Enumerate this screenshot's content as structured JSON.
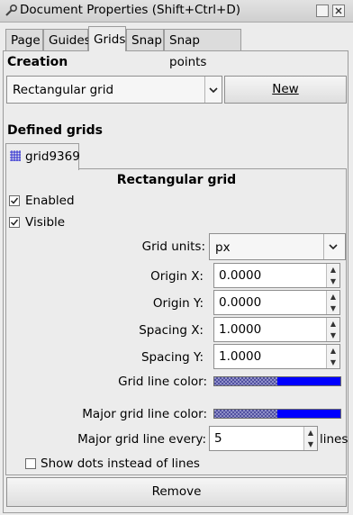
{
  "window": {
    "title": "Document Properties (Shift+Ctrl+D)"
  },
  "tabs": [
    {
      "label": "Page"
    },
    {
      "label": "Guides"
    },
    {
      "label": "Grids",
      "active": true
    },
    {
      "label": "Snap"
    },
    {
      "label": "Snap points"
    }
  ],
  "creation": {
    "heading": "Creation",
    "grid_type_selected": "Rectangular grid",
    "new_button_label": "New"
  },
  "defined_grids": {
    "heading": "Defined grids",
    "grid_tab_label": "grid9369",
    "grid_heading": "Rectangular grid",
    "enabled_label": "Enabled",
    "enabled_checked": true,
    "visible_label": "Visible",
    "visible_checked": true,
    "grid_units_label": "Grid units:",
    "grid_units_value": "px",
    "origin_x_label": "Origin X:",
    "origin_x_value": "0.0000",
    "origin_y_label": "Origin Y:",
    "origin_y_value": "0.0000",
    "spacing_x_label": "Spacing X:",
    "spacing_x_value": "1.0000",
    "spacing_y_label": "Spacing Y:",
    "spacing_y_value": "1.0000",
    "grid_line_color_label": "Grid line color:",
    "grid_line_color": "#0000ff",
    "major_grid_line_color_label": "Major grid line color:",
    "major_grid_line_color": "#0000ff",
    "major_every_label": "Major grid line every:",
    "major_every_value": "5",
    "major_every_unit": "lines",
    "show_dots_label": "Show dots instead of lines",
    "show_dots_checked": false,
    "remove_button_label": "Remove"
  }
}
